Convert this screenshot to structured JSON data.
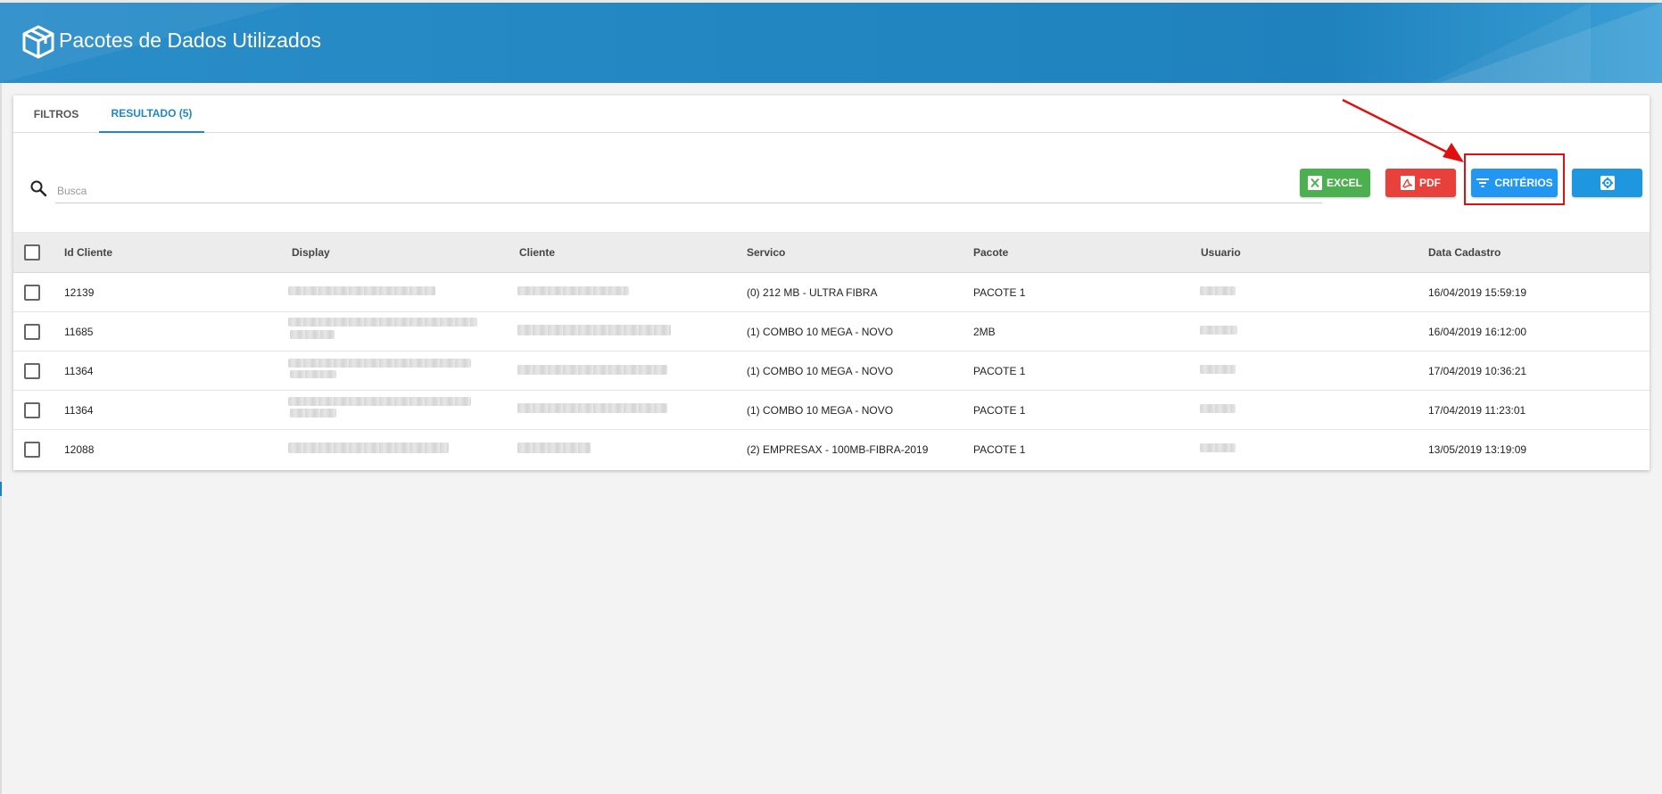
{
  "header": {
    "title": "Pacotes de Dados Utilizados",
    "logo_icon": "box-icon"
  },
  "tabs": [
    {
      "label": "FILTROS",
      "active": false
    },
    {
      "label": "RESULTADO (5)",
      "active": true
    }
  ],
  "search": {
    "placeholder": "Busca",
    "value": ""
  },
  "toolbar": {
    "excel_label": "EXCEL",
    "pdf_label": "PDF",
    "criterios_label": "CRITÉRIOS",
    "settings_icon": "settings-icon"
  },
  "table": {
    "columns": [
      "Id Cliente",
      "Display",
      "Cliente",
      "Servico",
      "Pacote",
      "Usuario",
      "Data Cadastro"
    ],
    "rows": [
      {
        "id": "12139",
        "servico": "(0) 212 MB - ULTRA FIBRA",
        "pacote": "PACOTE 1",
        "data": "16/04/2019 15:59:19"
      },
      {
        "id": "11685",
        "servico": "(1) COMBO 10 MEGA - NOVO",
        "pacote": "2MB",
        "data": "16/04/2019 16:12:00"
      },
      {
        "id": "11364",
        "servico": "(1) COMBO 10 MEGA - NOVO",
        "pacote": "PACOTE 1",
        "data": "17/04/2019 10:36:21"
      },
      {
        "id": "11364",
        "servico": "(1) COMBO 10 MEGA - NOVO",
        "pacote": "PACOTE 1",
        "data": "17/04/2019 11:23:01"
      },
      {
        "id": "12088",
        "servico": "(2) EMPRESAX - 100MB-FIBRA-2019",
        "pacote": "PACOTE 1",
        "data": "13/05/2019 13:19:09"
      }
    ]
  },
  "colors": {
    "header": "#2287c1",
    "excel": "#4caf50",
    "pdf": "#e8413b",
    "criterios": "#2196f3",
    "highlight": "#e01010"
  }
}
